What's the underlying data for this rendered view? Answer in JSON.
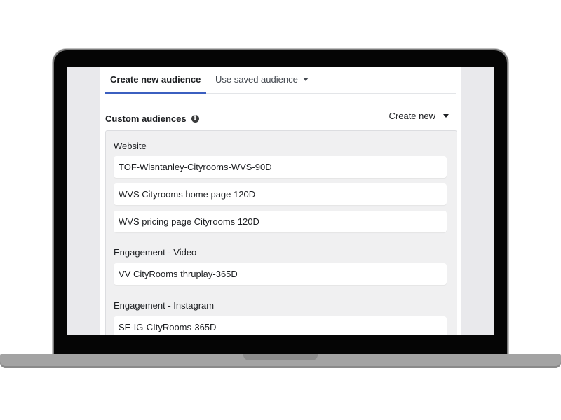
{
  "tabs": [
    {
      "label": "Create new audience"
    },
    {
      "label": "Use saved audience"
    }
  ],
  "section": {
    "title": "Custom audiences",
    "info_icon": "i",
    "create_new_label": "Create new"
  },
  "groups": [
    {
      "label": "Website",
      "items": [
        {
          "label": "TOF-Wisntanley-Cityrooms-WVS-90D"
        },
        {
          "label": "WVS Cityrooms home page 120D"
        },
        {
          "label": "WVS pricing page Cityrooms 120D"
        }
      ]
    },
    {
      "label": "Engagement - Video",
      "items": [
        {
          "label": "VV CityRooms thruplay-365D"
        }
      ]
    },
    {
      "label": "Engagement - Instagram",
      "items": [
        {
          "label": "SE-IG-CItyRooms-365D"
        }
      ]
    }
  ],
  "colors": {
    "active_tab_underline": "#3b5fc0",
    "list_background": "#f0f0f1",
    "screen_background": "#e9e9ec"
  }
}
